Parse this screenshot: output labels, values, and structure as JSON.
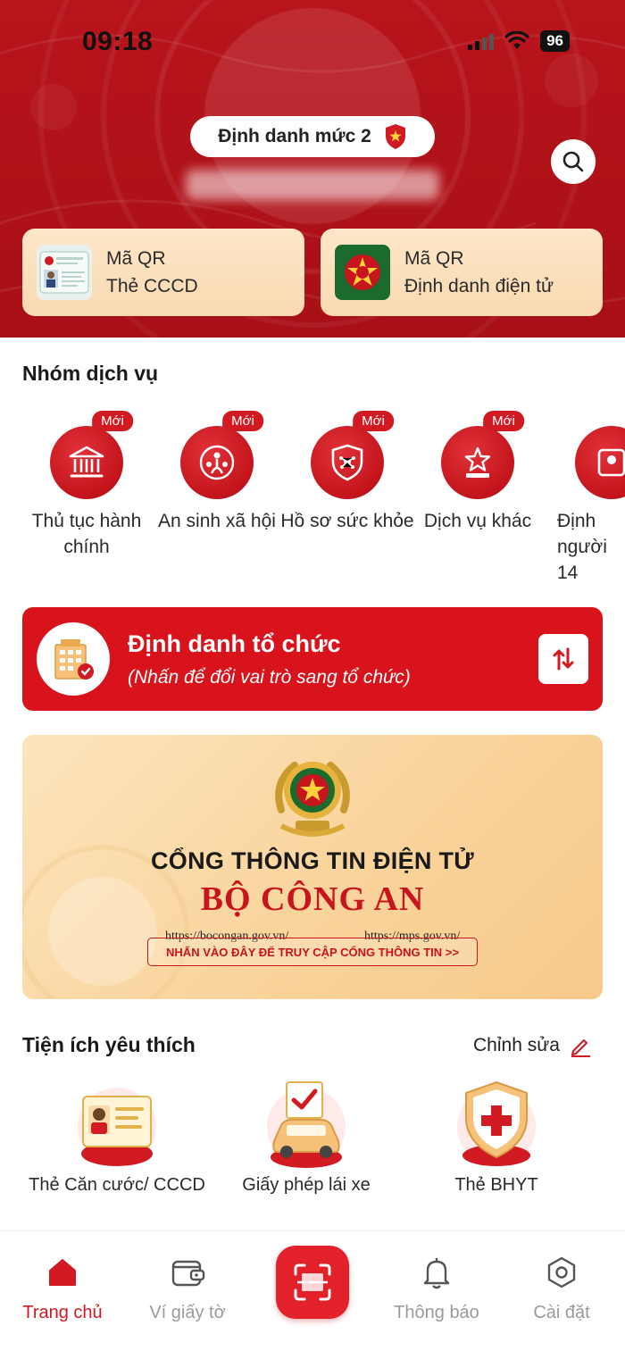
{
  "status_bar": {
    "time": "09:18",
    "battery": "96"
  },
  "header": {
    "level_label": "Định danh mức 2",
    "qr_cards": [
      {
        "line1": "Mã QR",
        "line2": "Thẻ CCCD"
      },
      {
        "line1": "Mã QR",
        "line2": "Định danh điện tử"
      }
    ]
  },
  "services": {
    "title": "Nhóm dịch vụ",
    "badge": "Mới",
    "items": [
      {
        "label": "Thủ tục hành chính",
        "icon": "bank-icon"
      },
      {
        "label": "An sinh xã hội",
        "icon": "community-icon"
      },
      {
        "label": "Hồ sơ sức khỏe",
        "icon": "health-shield-icon"
      },
      {
        "label": "Dịch vụ khác",
        "icon": "star-pedestal-icon"
      },
      {
        "label": "Định người 14",
        "icon": "id-scan-icon"
      }
    ]
  },
  "org_card": {
    "title": "Định danh tổ chức",
    "subtitle": "(Nhấn để đổi vai trò sang tổ chức)"
  },
  "banner": {
    "title1": "CỔNG THÔNG TIN ĐIỆN TỬ",
    "title2": "BỘ CÔNG AN",
    "url1": "https://bocongan.gov.vn/",
    "url2": "https://mps.gov.vn/",
    "cta": "NHẤN VÀO ĐÂY ĐỂ TRUY CẬP CỔNG THÔNG TIN >>"
  },
  "favorites": {
    "title": "Tiện ích yêu thích",
    "edit_label": "Chỉnh sửa",
    "items": [
      {
        "label": "Thẻ Căn cước/ CCCD"
      },
      {
        "label": "Giấy phép lái xe"
      },
      {
        "label": "Thẻ BHYT"
      }
    ]
  },
  "bottom_nav": {
    "items": [
      {
        "label": "Trang chủ"
      },
      {
        "label": "Ví giấy tờ"
      },
      {
        "label": "Thông báo"
      },
      {
        "label": "Cài đặt"
      }
    ]
  },
  "colors": {
    "primary_red": "#d11a22",
    "header_red": "#b3131a",
    "card_cream": "#fde7c9"
  }
}
